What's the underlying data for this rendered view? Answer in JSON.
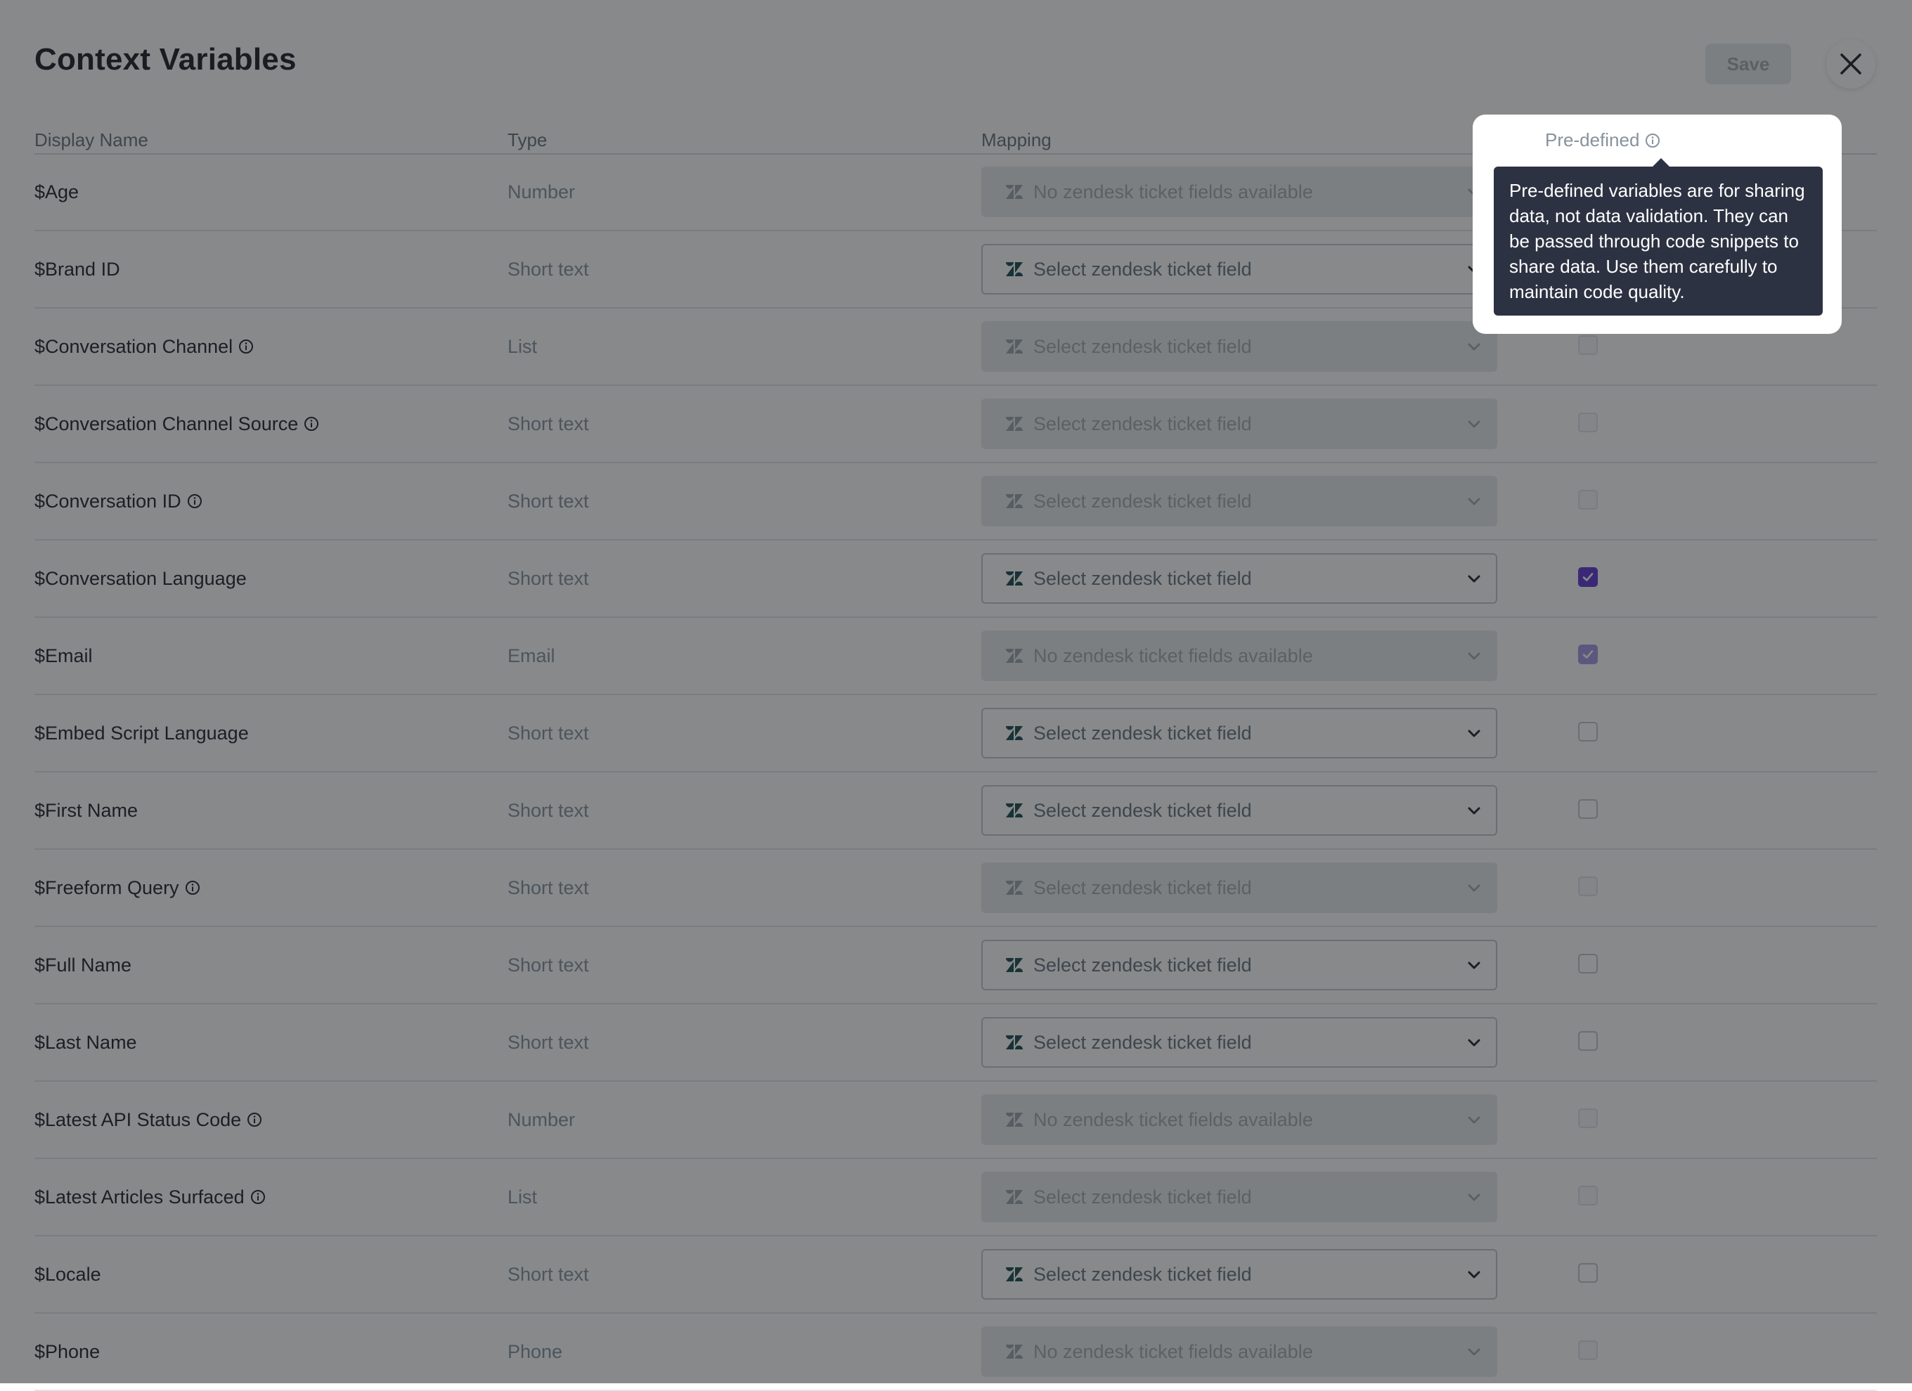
{
  "modal": {
    "title": "Context Variables",
    "save_label": "Save",
    "close_label": "close"
  },
  "columns": {
    "display_name": "Display Name",
    "type": "Type",
    "mapping": "Mapping",
    "predefined": "Pre-defined"
  },
  "tooltip": {
    "text": "Pre-defined variables are for sharing data, not data validation. They can be passed through code snippets to share data. Use them carefully to maintain code quality."
  },
  "rows": [
    {
      "name": "$Age",
      "info": false,
      "type": "Number",
      "mapping": "No zendesk ticket fields available",
      "enabled": false,
      "checked": false
    },
    {
      "name": "$Brand ID",
      "info": false,
      "type": "Short text",
      "mapping": "Select zendesk ticket field",
      "enabled": true,
      "checked": false
    },
    {
      "name": "$Conversation Channel",
      "info": true,
      "type": "List",
      "mapping": "Select zendesk ticket field",
      "enabled": false,
      "checked": false
    },
    {
      "name": "$Conversation Channel Source",
      "info": true,
      "type": "Short text",
      "mapping": "Select zendesk ticket field",
      "enabled": false,
      "checked": false
    },
    {
      "name": "$Conversation ID",
      "info": true,
      "type": "Short text",
      "mapping": "Select zendesk ticket field",
      "enabled": false,
      "checked": false
    },
    {
      "name": "$Conversation Language",
      "info": false,
      "type": "Short text",
      "mapping": "Select zendesk ticket field",
      "enabled": true,
      "checked": true
    },
    {
      "name": "$Email",
      "info": false,
      "type": "Email",
      "mapping": "No zendesk ticket fields available",
      "enabled": false,
      "checked": true
    },
    {
      "name": "$Embed Script Language",
      "info": false,
      "type": "Short text",
      "mapping": "Select zendesk ticket field",
      "enabled": true,
      "checked": false
    },
    {
      "name": "$First Name",
      "info": false,
      "type": "Short text",
      "mapping": "Select zendesk ticket field",
      "enabled": true,
      "checked": false
    },
    {
      "name": "$Freeform Query",
      "info": true,
      "type": "Short text",
      "mapping": "Select zendesk ticket field",
      "enabled": false,
      "checked": false
    },
    {
      "name": "$Full Name",
      "info": false,
      "type": "Short text",
      "mapping": "Select zendesk ticket field",
      "enabled": true,
      "checked": false
    },
    {
      "name": "$Last Name",
      "info": false,
      "type": "Short text",
      "mapping": "Select zendesk ticket field",
      "enabled": true,
      "checked": false
    },
    {
      "name": "$Latest API Status Code",
      "info": true,
      "type": "Number",
      "mapping": "No zendesk ticket fields available",
      "enabled": false,
      "checked": false
    },
    {
      "name": "$Latest Articles Surfaced",
      "info": true,
      "type": "List",
      "mapping": "Select zendesk ticket field",
      "enabled": false,
      "checked": false
    },
    {
      "name": "$Locale",
      "info": false,
      "type": "Short text",
      "mapping": "Select zendesk ticket field",
      "enabled": true,
      "checked": false
    },
    {
      "name": "$Phone",
      "info": false,
      "type": "Phone",
      "mapping": "No zendesk ticket fields available",
      "enabled": false,
      "checked": false
    }
  ],
  "colors": {
    "accent": "#5f36d6",
    "tooltip_bg": "#2d3242",
    "zendesk_logo": "#17494d"
  },
  "icons": {
    "close": "close-icon",
    "info": "info-icon",
    "zendesk": "zendesk-logo-icon",
    "chevron": "chevron-down-icon",
    "check": "checkmark-icon"
  }
}
